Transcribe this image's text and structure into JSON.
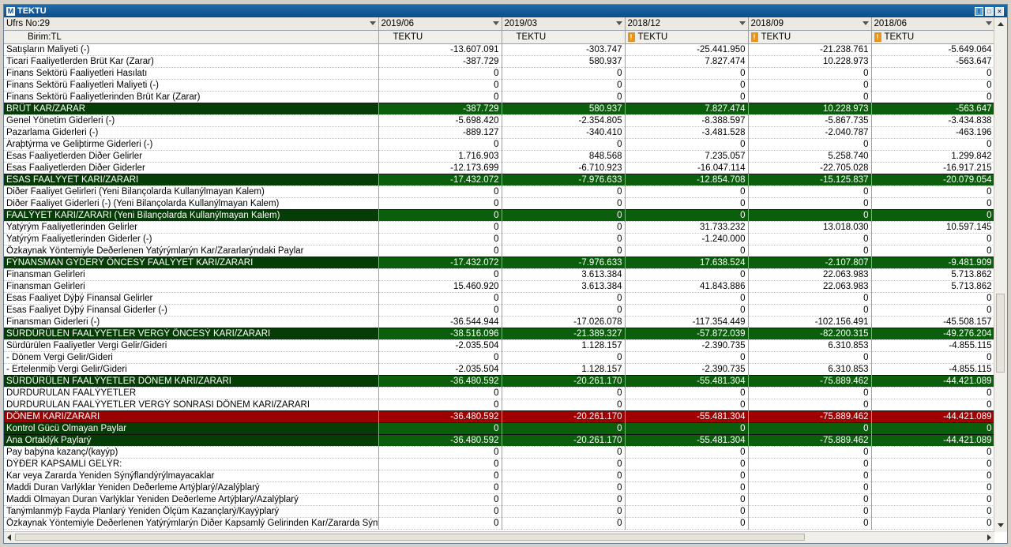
{
  "window": {
    "title": "TEKTU",
    "logo": "M"
  },
  "header": {
    "first_col_label": "Ufrs No:29",
    "unit_label": "Birim:TL",
    "periods": [
      "2019/06",
      "2019/03",
      "2018/12",
      "2018/09",
      "2018/06"
    ],
    "symbols": [
      "TEKTU",
      "TEKTU",
      "TEKTU",
      "TEKTU",
      "TEKTU"
    ],
    "warn": [
      false,
      false,
      true,
      true,
      true
    ]
  },
  "rows": [
    {
      "label": "Satışların Maliyeti (-)",
      "v": [
        "-13.607.091",
        "-303.747",
        "-25.441.950",
        "-21.238.761",
        "-5.649.064"
      ],
      "style": ""
    },
    {
      "label": "Ticari Faaliyetlerden Brüt Kar (Zarar)",
      "v": [
        "-387.729",
        "580.937",
        "7.827.474",
        "10.228.973",
        "-563.647"
      ],
      "style": ""
    },
    {
      "label": "Finans Sektörü Faaliyetleri Hasılatı",
      "v": [
        "0",
        "0",
        "0",
        "0",
        "0"
      ],
      "style": ""
    },
    {
      "label": "Finans Sektörü Faaliyetleri Maliyeti  (-)",
      "v": [
        "0",
        "0",
        "0",
        "0",
        "0"
      ],
      "style": ""
    },
    {
      "label": "Finans Sektörü Faaliyetlerinden Brüt Kar (Zarar)",
      "v": [
        "0",
        "0",
        "0",
        "0",
        "0"
      ],
      "style": ""
    },
    {
      "label": "BRÜT KAR/ZARAR",
      "v": [
        "-387.729",
        "580.937",
        "7.827.474",
        "10.228.973",
        "-563.647"
      ],
      "style": "g"
    },
    {
      "label": "Genel Yönetim Giderleri (-)",
      "v": [
        "-5.698.420",
        "-2.354.805",
        "-8.388.597",
        "-5.867.735",
        "-3.434.838"
      ],
      "style": ""
    },
    {
      "label": "Pazarlama Giderleri (-)",
      "v": [
        "-889.127",
        "-340.410",
        "-3.481.528",
        "-2.040.787",
        "-463.196"
      ],
      "style": ""
    },
    {
      "label": "Araþtýrma ve Geliþtirme Giderleri (-)",
      "v": [
        "0",
        "0",
        "0",
        "0",
        "0"
      ],
      "style": ""
    },
    {
      "label": "Esas Faaliyetlerden Diðer Gelirler",
      "v": [
        "1.716.903",
        "848.568",
        "7.235.057",
        "5.258.740",
        "1.299.842"
      ],
      "style": ""
    },
    {
      "label": "Esas Faaliyetlerden Diðer Giderler",
      "v": [
        "-12.173.699",
        "-6.710.923",
        "-16.047.114",
        "-22.705.028",
        "-16.917.215"
      ],
      "style": ""
    },
    {
      "label": "ESAS FAALÝYET KARI/ZARARI",
      "v": [
        "-17.432.072",
        "-7.976.633",
        "-12.854.708",
        "-15.125.837",
        "-20.079.054"
      ],
      "style": "g"
    },
    {
      "label": "Diðer Faaliyet Gelirleri    (Yeni Bilançolarda Kullanýlmayan Kalem)",
      "v": [
        "0",
        "0",
        "0",
        "0",
        "0"
      ],
      "style": ""
    },
    {
      "label": "Diðer Faaliyet Giderleri (-)     (Yeni Bilançolarda Kullanýlmayan Kalem)",
      "v": [
        "0",
        "0",
        "0",
        "0",
        "0"
      ],
      "style": ""
    },
    {
      "label": "FAALÝYET KARI/ZARARI     (Yeni Bilançolarda Kullanýlmayan Kalem)",
      "v": [
        "0",
        "0",
        "0",
        "0",
        "0"
      ],
      "style": "g"
    },
    {
      "label": "Yatýrým Faaliyetlerinden Gelirler",
      "v": [
        "0",
        "0",
        "31.733.232",
        "13.018.030",
        "10.597.145"
      ],
      "style": ""
    },
    {
      "label": "Yatýrým Faaliyetlerinden Giderler (-)",
      "v": [
        "0",
        "0",
        "-1.240.000",
        "0",
        "0"
      ],
      "style": ""
    },
    {
      "label": "Özkaynak Yöntemiyle Deðerlenen Yatýrýmlarýn Kar/Zararlarýndaki Paylar",
      "v": [
        "0",
        "0",
        "0",
        "0",
        "0"
      ],
      "style": ""
    },
    {
      "label": "FÝNANSMAN GÝDERÝ ÖNCESÝ FAALÝYET KARI/ZARARI",
      "v": [
        "-17.432.072",
        "-7.976.633",
        "17.638.524",
        "-2.107.807",
        "-9.481.909"
      ],
      "style": "g"
    },
    {
      "label": "Finansman Gelirleri",
      "v": [
        "0",
        "3.613.384",
        "0",
        "22.063.983",
        "5.713.862"
      ],
      "style": ""
    },
    {
      "label": "Finansman Gelirleri",
      "v": [
        "15.460.920",
        "3.613.384",
        "41.843.886",
        "22.063.983",
        "5.713.862"
      ],
      "style": ""
    },
    {
      "label": "Esas Faaliyet Dýþý Finansal Gelirler",
      "v": [
        "0",
        "0",
        "0",
        "0",
        "0"
      ],
      "style": ""
    },
    {
      "label": "Esas Faaliyet Dýþý Finansal Giderler (-)",
      "v": [
        "0",
        "0",
        "0",
        "0",
        "0"
      ],
      "style": ""
    },
    {
      "label": "Finansman Giderleri (-)",
      "v": [
        "-36.544.944",
        "-17.026.078",
        "-117.354.449",
        "-102.156.491",
        "-45.508.157"
      ],
      "style": ""
    },
    {
      "label": "SÜRDÜRÜLEN FAALÝYETLER VERGÝ ÖNCESÝ KARI/ZARARI",
      "v": [
        "-38.516.096",
        "-21.389.327",
        "-57.872.039",
        "-82.200.315",
        "-49.276.204"
      ],
      "style": "g"
    },
    {
      "label": "Sürdürülen Faaliyetler Vergi Gelir/Gideri",
      "v": [
        "-2.035.504",
        "1.128.157",
        "-2.390.735",
        "6.310.853",
        "-4.855.115"
      ],
      "style": ""
    },
    {
      "label": " - Dönem Vergi Gelir/Gideri",
      "v": [
        "0",
        "0",
        "0",
        "0",
        "0"
      ],
      "style": ""
    },
    {
      "label": " - Ertelenmiþ Vergi Gelir/Gideri",
      "v": [
        "-2.035.504",
        "1.128.157",
        "-2.390.735",
        "6.310.853",
        "-4.855.115"
      ],
      "style": ""
    },
    {
      "label": "SÜRDÜRÜLEN FAALÝYETLER DÖNEM KARI/ZARARI",
      "v": [
        "-36.480.592",
        "-20.261.170",
        "-55.481.304",
        "-75.889.462",
        "-44.421.089"
      ],
      "style": "g"
    },
    {
      "label": "DURDURULAN FAALÝYETLER",
      "v": [
        "0",
        "0",
        "0",
        "0",
        "0"
      ],
      "style": ""
    },
    {
      "label": "DURDURULAN FAALÝYETLER VERGÝ SONRASI DÖNEM KARI/ZARARI",
      "v": [
        "0",
        "0",
        "0",
        "0",
        "0"
      ],
      "style": ""
    },
    {
      "label": "DÖNEM KARI/ZARARI",
      "v": [
        "-36.480.592",
        "-20.261.170",
        "-55.481.304",
        "-75.889.462",
        "-44.421.089"
      ],
      "style": "r"
    },
    {
      "label": "Kontrol Gücü Olmayan Paylar",
      "v": [
        "0",
        "0",
        "0",
        "0",
        "0"
      ],
      "style": "g"
    },
    {
      "label": "Ana Ortaklýk Paylarý",
      "v": [
        "-36.480.592",
        "-20.261.170",
        "-55.481.304",
        "-75.889.462",
        "-44.421.089"
      ],
      "style": "g"
    },
    {
      "label": "Pay baþýna kazanç/(kayýp)",
      "v": [
        "0",
        "0",
        "0",
        "0",
        "0"
      ],
      "style": ""
    },
    {
      "label": "DÝÐER KAPSAMLI GELÝR:",
      "v": [
        "0",
        "0",
        "0",
        "0",
        "0"
      ],
      "style": ""
    },
    {
      "label": "Kar veya Zararda Yeniden Sýnýflandýrýlmayacaklar",
      "v": [
        "0",
        "0",
        "0",
        "0",
        "0"
      ],
      "style": ""
    },
    {
      "label": "Maddi Duran Varlýklar Yeniden Deðerleme Artýþlarý/Azalýþlarý",
      "v": [
        "0",
        "0",
        "0",
        "0",
        "0"
      ],
      "style": ""
    },
    {
      "label": "Maddi Olmayan Duran Varlýklar Yeniden Deðerleme Artýþlarý/Azalýþlarý",
      "v": [
        "0",
        "0",
        "0",
        "0",
        "0"
      ],
      "style": ""
    },
    {
      "label": "Tanýmlanmýþ Fayda Planlarý Yeniden Ölçüm Kazançlarý/Kayýplarý",
      "v": [
        "0",
        "0",
        "0",
        "0",
        "0"
      ],
      "style": ""
    },
    {
      "label": "Özkaynak Yöntemiyle Deðerlenen Yatýrýmlarýn Diðer Kapsamlý Gelirinden Kar/Zararda Sýnýf",
      "v": [
        "0",
        "0",
        "0",
        "0",
        "0"
      ],
      "style": ""
    }
  ]
}
